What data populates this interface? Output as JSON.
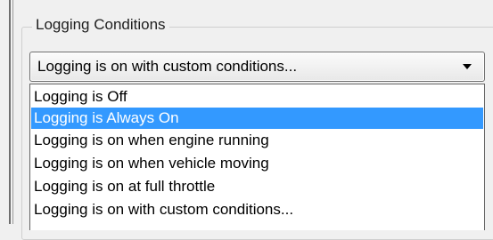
{
  "group": {
    "title": "Logging Conditions"
  },
  "combo": {
    "value": "Logging is on with custom conditions..."
  },
  "dropdown": {
    "options": [
      "Logging is Off",
      "Logging is Always On",
      "Logging is on when engine running",
      "Logging is on when vehicle moving",
      "Logging is on at full throttle",
      "Logging is on with custom conditions..."
    ],
    "highlighted_option": "Logging is Always On"
  },
  "colors": {
    "highlight": "#3399ff",
    "highlight_text": "#ffffff"
  },
  "icons": {
    "dropdown_arrow": "chevron-down-icon"
  }
}
